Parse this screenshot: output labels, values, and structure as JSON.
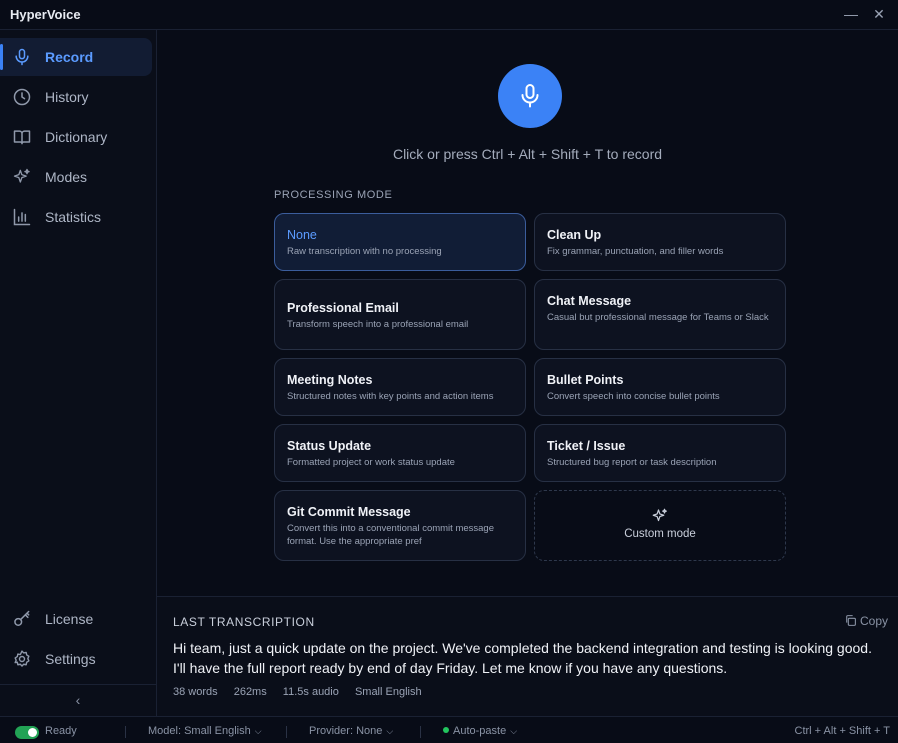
{
  "app": {
    "title": "HyperVoice"
  },
  "window": {
    "minimize": "—",
    "close": "✕"
  },
  "sidebar": {
    "items": [
      {
        "label": "Record",
        "icon": "microphone-icon",
        "active": true
      },
      {
        "label": "History",
        "icon": "clock-icon"
      },
      {
        "label": "Dictionary",
        "icon": "book-icon"
      },
      {
        "label": "Modes",
        "icon": "sparkles-icon"
      },
      {
        "label": "Statistics",
        "icon": "bar-chart-icon"
      }
    ],
    "bottom": [
      {
        "label": "License",
        "icon": "key-icon"
      },
      {
        "label": "Settings",
        "icon": "gear-icon"
      }
    ],
    "collapse_glyph": "‹"
  },
  "record": {
    "hint": "Click or press Ctrl + Alt + Shift + T to record",
    "accent": "#3b82f6"
  },
  "processing": {
    "label": "PROCESSING MODE",
    "modes": [
      {
        "title": "None",
        "desc": "Raw transcription with no processing",
        "selected": true
      },
      {
        "title": "Clean Up",
        "desc": "Fix grammar, punctuation, and filler words"
      },
      {
        "title": "Professional Email",
        "desc": "Transform speech into a professional email"
      },
      {
        "title": "Chat Message",
        "desc": "Casual but professional message for Teams or Slack"
      },
      {
        "title": "Meeting Notes",
        "desc": "Structured notes with key points and action items"
      },
      {
        "title": "Bullet Points",
        "desc": "Convert speech into concise bullet points"
      },
      {
        "title": "Status Update",
        "desc": "Formatted project or work status update"
      },
      {
        "title": "Ticket / Issue",
        "desc": "Structured bug report or task description"
      },
      {
        "title": "Git Commit Message",
        "desc": "Convert this into a conventional commit message format. Use the appropriate pref"
      }
    ],
    "custom_label": "Custom mode"
  },
  "transcription": {
    "heading": "LAST TRANSCRIPTION",
    "copy_label": "Copy",
    "text": "Hi team, just a quick update on the project. We've completed the backend integration and testing is looking good. I'll have the full report ready by end of day Friday. Let me know if you have any questions.",
    "meta": {
      "words": "38 words",
      "latency": "262ms",
      "audio": "11.5s audio",
      "model": "Small English"
    }
  },
  "status": {
    "ready": "Ready",
    "model": "Model: Small English",
    "provider": "Provider: None",
    "autopaste": "Auto-paste",
    "shortcut": "Ctrl + Alt + Shift + T",
    "ready_color": "#22a355"
  }
}
